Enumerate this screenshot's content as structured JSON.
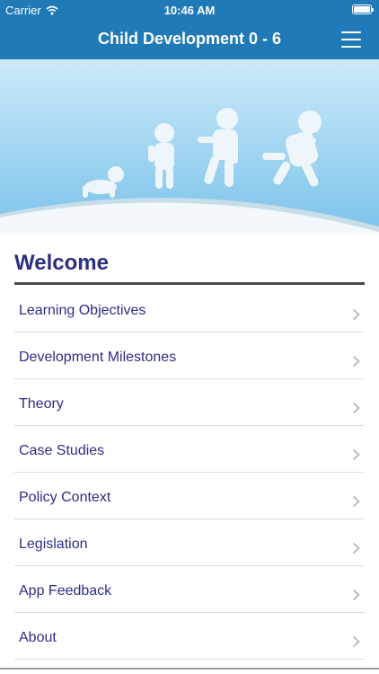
{
  "status_bar": {
    "carrier": "Carrier",
    "time": "10:46 AM",
    "battery_level": 1.0
  },
  "nav_bar": {
    "title": "Child Development 0 - 6"
  },
  "section": {
    "title": "Welcome"
  },
  "menu": {
    "items": [
      {
        "label": "Learning Objectives"
      },
      {
        "label": "Development Milestones"
      },
      {
        "label": "Theory"
      },
      {
        "label": "Case Studies"
      },
      {
        "label": "Policy Context"
      },
      {
        "label": "Legislation"
      },
      {
        "label": "App Feedback"
      },
      {
        "label": "About"
      }
    ]
  },
  "colors": {
    "brand_blue": "#1f7ab7",
    "title_purple": "#2b2e84",
    "sky_light": "#9fd4f1"
  }
}
